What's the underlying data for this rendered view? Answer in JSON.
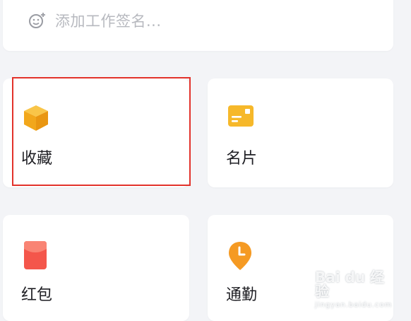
{
  "signature": {
    "placeholder": "添加工作签名...",
    "icon": "add-emoji-icon"
  },
  "features": [
    {
      "label": "收藏",
      "icon": "favorites-box-icon",
      "color": "#f5b326"
    },
    {
      "label": "名片",
      "icon": "business-card-icon",
      "color": "#f5b326"
    },
    {
      "label": "红包",
      "icon": "red-envelope-icon",
      "color": "#f5564a"
    },
    {
      "label": "通勤",
      "icon": "commute-location-icon",
      "color": "#f59a23"
    }
  ],
  "highlight": {
    "target": "收藏",
    "color": "#e2322b"
  },
  "watermark": {
    "brand": "Bai du 经验",
    "sub": "jingyan.baidu.com"
  }
}
